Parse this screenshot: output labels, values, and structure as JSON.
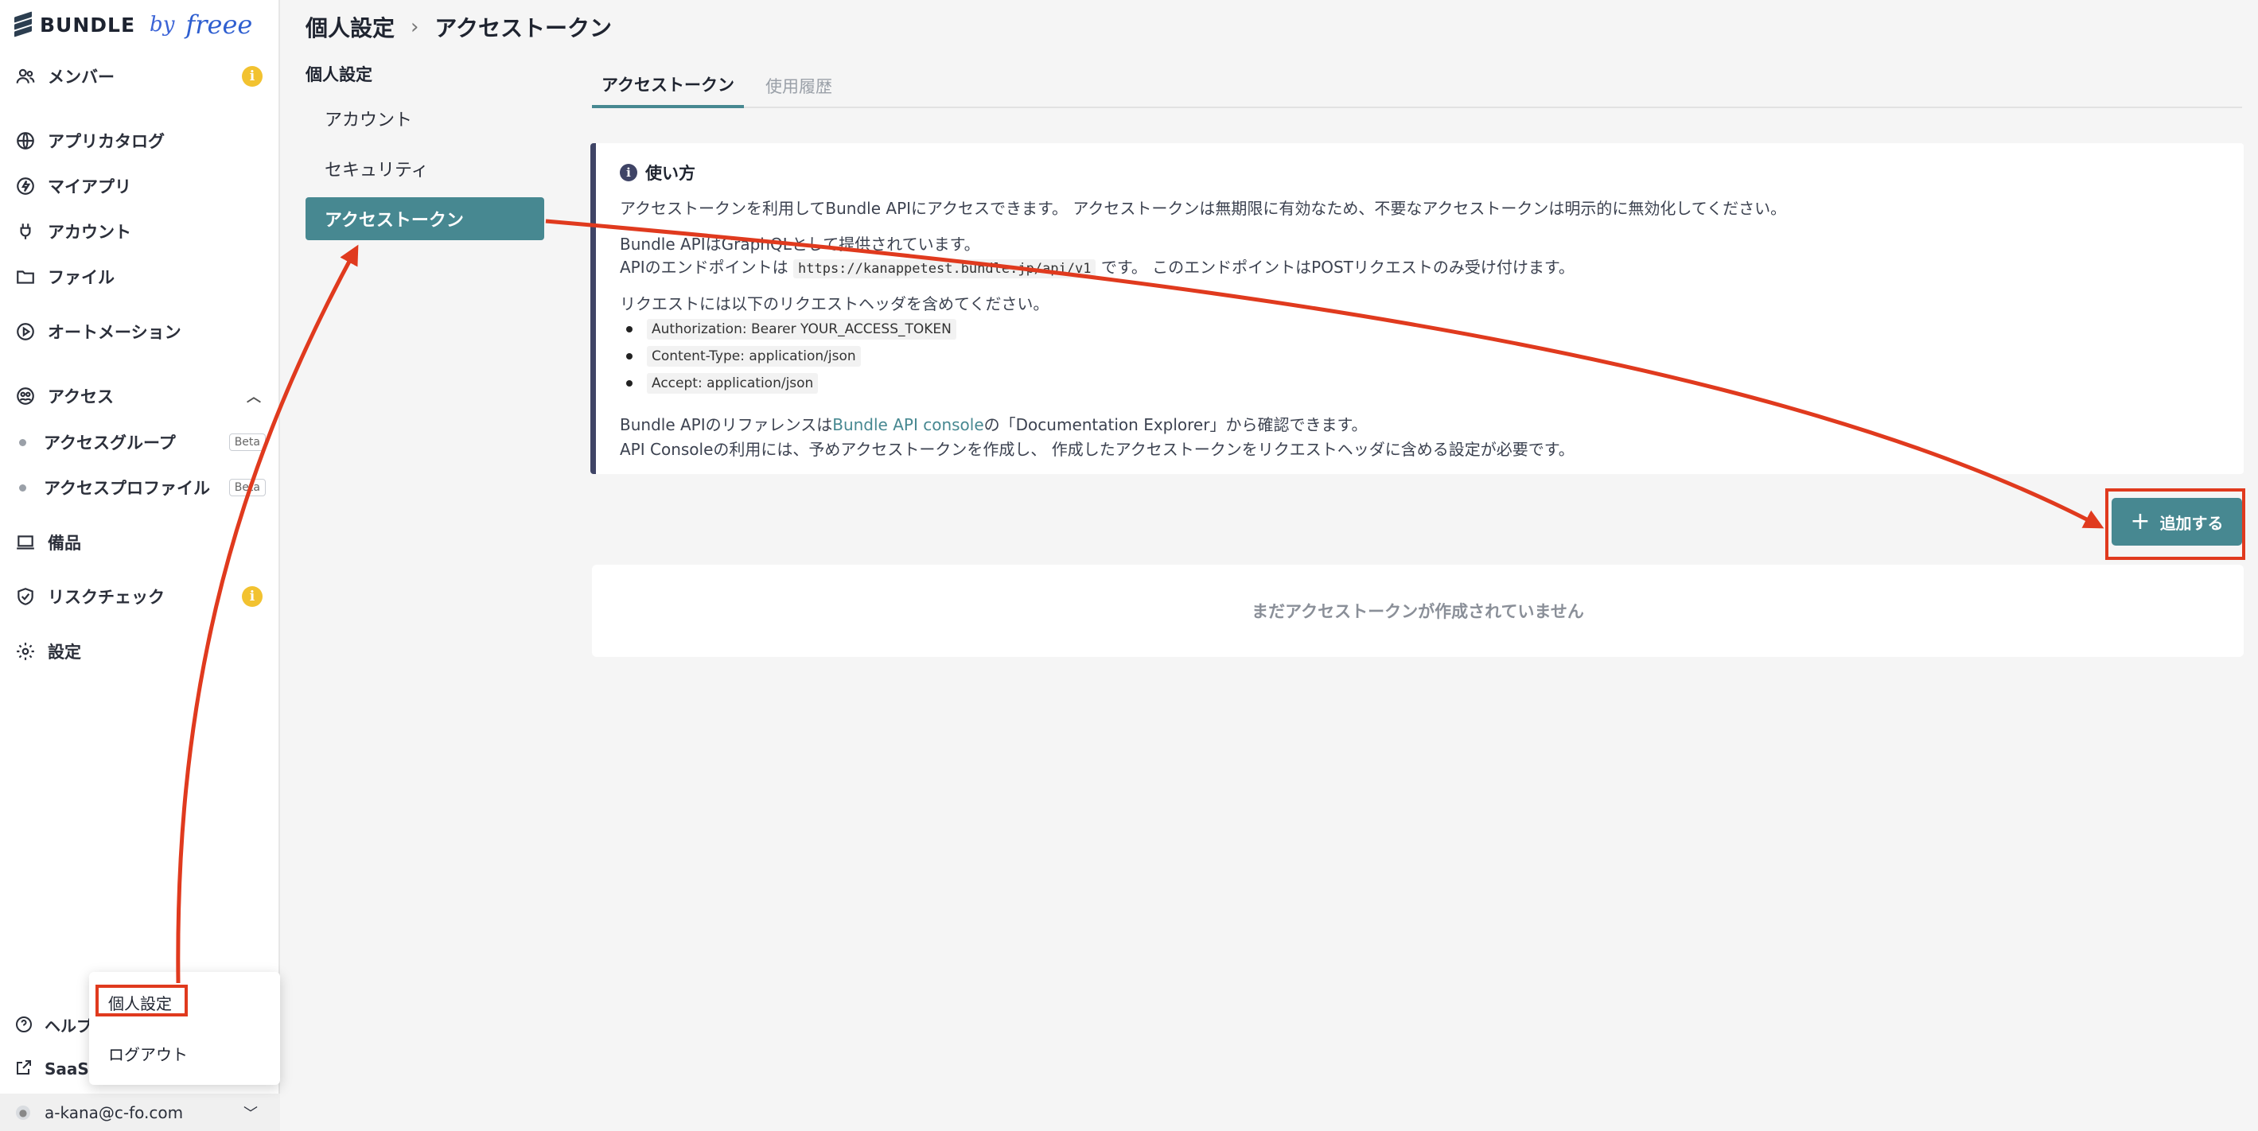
{
  "logo": {
    "brand": "BUNDLE",
    "by": "by",
    "partner": "freee"
  },
  "sidebar": {
    "items": [
      {
        "label": "メンバー",
        "icon": "users-icon",
        "info": "i"
      },
      {
        "label": "アプリカタログ",
        "icon": "globe-icon"
      },
      {
        "label": "マイアプリ",
        "icon": "bolt-icon"
      },
      {
        "label": "アカウント",
        "icon": "plug-icon"
      },
      {
        "label": "ファイル",
        "icon": "folder-icon"
      },
      {
        "label": "オートメーション",
        "icon": "play-icon"
      },
      {
        "label": "アクセス",
        "icon": "access-icon",
        "expanded": true
      },
      {
        "label": "備品",
        "icon": "laptop-icon"
      },
      {
        "label": "リスクチェック",
        "icon": "shield-check-icon",
        "info": "i"
      },
      {
        "label": "設定",
        "icon": "gear-icon"
      }
    ],
    "sub_items": [
      {
        "label": "アクセスグループ",
        "badge": "Beta"
      },
      {
        "label": "アクセスプロファイル",
        "badge": "Beta"
      }
    ],
    "bottom": [
      {
        "label": "ヘルプ",
        "icon": "help-icon"
      },
      {
        "label": "SaaSセ",
        "icon": "external-link-icon"
      }
    ],
    "user_email": "a-kana@c-fo.com"
  },
  "popup_menu": {
    "items": [
      "個人設定",
      "ログアウト"
    ]
  },
  "breadcrumb": {
    "parent": "個人設定",
    "separator": "›",
    "current": "アクセストークン"
  },
  "settings_nav": {
    "heading": "個人設定",
    "items": [
      "アカウント",
      "セキュリティ",
      "アクセストークン"
    ],
    "active": "アクセストークン"
  },
  "tabs": [
    "アクセストークン",
    "使用履歴"
  ],
  "howto": {
    "title": "使い方",
    "p1": "アクセストークンを利用してBundle APIにアクセスできます。 アクセストークンは無期限に有効なため、不要なアクセストークンは明示的に無効化してください。",
    "p2a": "Bundle APIはGraphQLとして提供されています。",
    "p2b_pre": "APIのエンドポイントは",
    "endpoint": "https://kanappetest.bundle.jp/api/v1",
    "p2b_post": "です。 このエンドポイントはPOSTリクエストのみ受け付けます。",
    "p3": "リクエストには以下のリクエストヘッダを含めてください。",
    "headers": [
      "Authorization: Bearer YOUR_ACCESS_TOKEN",
      "Content-Type: application/json",
      "Accept: application/json"
    ],
    "p4_pre": "Bundle APIのリファレンスは",
    "p4_link": "Bundle API console",
    "p4_post": "の「Documentation Explorer」から確認できます。",
    "p5": "API Consoleの利用には、予めアクセストークンを作成し、 作成したアクセストークンをリクエストヘッダに含める設定が必要です。"
  },
  "add_button": {
    "icon": "plus-icon",
    "label": "追加する"
  },
  "empty_state": "まだアクセストークンが作成されていません",
  "colors": {
    "accent": "#478891",
    "annotation": "#e03a1e",
    "panel_border": "#3f4466",
    "warning": "#f2c230"
  }
}
